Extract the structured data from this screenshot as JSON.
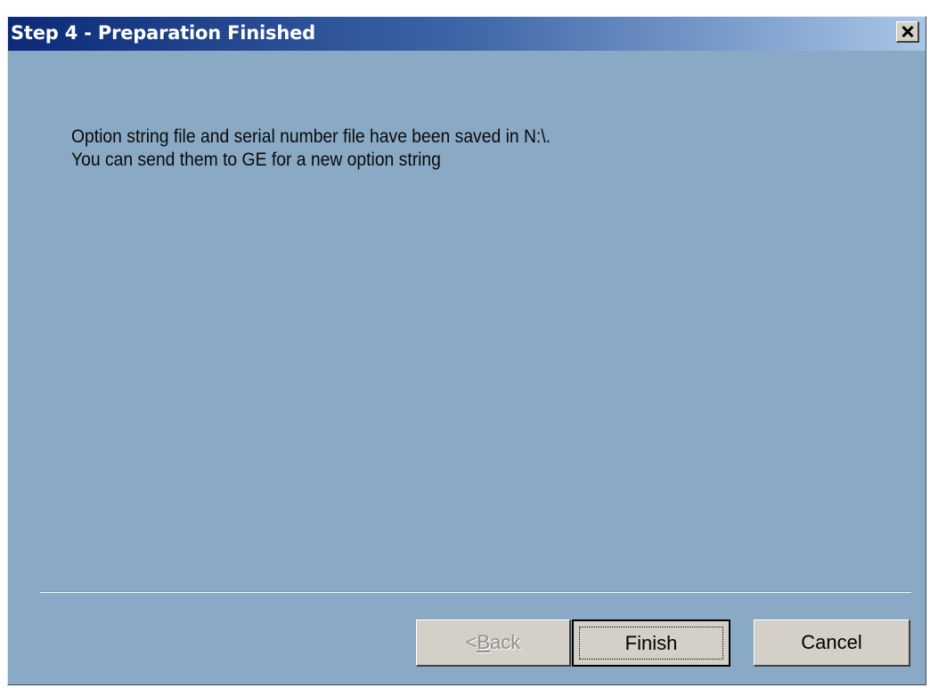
{
  "window": {
    "title": "Step 4 - Preparation Finished",
    "close_icon": "close-icon"
  },
  "message": {
    "line1": "Option string file and serial number file have been saved in N:\\.",
    "line2": "You can send them to GE for a new option string"
  },
  "buttons": {
    "back_prefix": "< ",
    "back_mnemonic": "B",
    "back_rest": "ack",
    "back_enabled": false,
    "finish_label": "Finish",
    "finish_default": true,
    "cancel_label": "Cancel"
  },
  "colors": {
    "dialog_background": "#8aa9c4",
    "titlebar_start": "#0b2a78",
    "titlebar_end": "#a9c6e6",
    "button_face": "#d4d0c8"
  }
}
